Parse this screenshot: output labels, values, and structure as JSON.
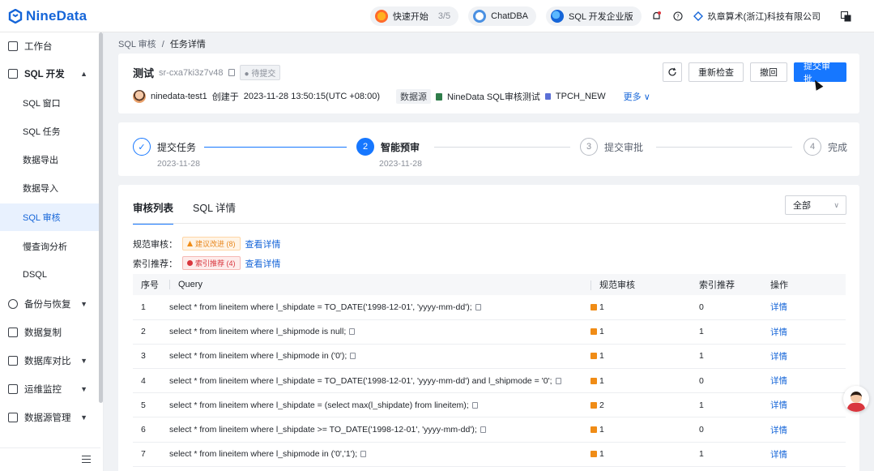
{
  "brand": {
    "name": "NineData"
  },
  "topbar": {
    "quick_start": "快速开始",
    "quick_start_progress": "3/5",
    "chatdba": "ChatDBA",
    "edition": "SQL 开发企业版",
    "company": "玖章算术(浙江)科技有限公司"
  },
  "sidebar": {
    "items": [
      {
        "label": "工作台",
        "icon": "home-icon"
      },
      {
        "label": "SQL 开发",
        "icon": "monitor-icon",
        "expanded": true
      },
      {
        "label": "备份与恢复",
        "icon": "backup-icon"
      },
      {
        "label": "数据复制",
        "icon": "replicate-icon"
      },
      {
        "label": "数据库对比",
        "icon": "compare-icon"
      },
      {
        "label": "运维监控",
        "icon": "monitor-ops-icon"
      },
      {
        "label": "数据源管理",
        "icon": "datasource-icon"
      }
    ],
    "sub_items": [
      "SQL 窗口",
      "SQL 任务",
      "数据导出",
      "数据导入",
      "SQL 审核",
      "慢查询分析",
      "DSQL"
    ],
    "active_sub": "SQL 审核"
  },
  "breadcrumb": {
    "parent": "SQL 审核",
    "separator": "/",
    "current": "任务详情"
  },
  "task": {
    "title": "测试",
    "id": "sr-cxa7ki3z7v48",
    "status": "待提交",
    "user": "ninedata-test1",
    "created_prefix": "创建于",
    "created_at": "2023-11-28 13:50:15(UTC +08:00)",
    "datasource_label": "数据源",
    "datasource": "NineData SQL审核测试",
    "database": "TPCH_NEW",
    "more": "更多"
  },
  "actions": {
    "refresh_icon": "refresh-icon",
    "recheck": "重新检查",
    "withdraw": "撤回",
    "submit": "提交审批"
  },
  "steps": [
    {
      "num": "1",
      "label": "提交任务",
      "date": "2023-11-28",
      "state": "done"
    },
    {
      "num": "2",
      "label": "智能预审",
      "date": "2023-11-28",
      "state": "active"
    },
    {
      "num": "3",
      "label": "提交审批",
      "date": "",
      "state": "pending"
    },
    {
      "num": "4",
      "label": "完成",
      "date": "",
      "state": "pending"
    }
  ],
  "review": {
    "tabs": [
      "审核列表",
      "SQL 详情"
    ],
    "filter": "全部",
    "rule_label": "规范审核：",
    "rule_tag": "建议改进 (8)",
    "index_label": "索引推荐：",
    "index_tag": "索引推荐 (4)",
    "view_details": "查看详情",
    "columns": [
      "序号",
      "Query",
      "规范审核",
      "索引推荐",
      "操作"
    ],
    "rows": [
      {
        "no": "1",
        "query": "select * from lineitem where l_shipdate = TO_DATE('1998-12-01', 'yyyy-mm-dd');",
        "rule": "1",
        "index": "0",
        "action": "详情"
      },
      {
        "no": "2",
        "query": "select * from lineitem where l_shipmode is null;",
        "rule": "1",
        "index": "1",
        "action": "详情"
      },
      {
        "no": "3",
        "query": "select * from lineitem where l_shipmode in ('0');",
        "rule": "1",
        "index": "1",
        "action": "详情"
      },
      {
        "no": "4",
        "query": "select * from lineitem where l_shipdate = TO_DATE('1998-12-01', 'yyyy-mm-dd') and l_shipmode = '0';",
        "rule": "1",
        "index": "0",
        "action": "详情"
      },
      {
        "no": "5",
        "query": "select * from lineitem where l_shipdate = (select max(l_shipdate) from lineitem);",
        "rule": "2",
        "index": "1",
        "action": "详情"
      },
      {
        "no": "6",
        "query": "select * from lineitem where l_shipdate >= TO_DATE('1998-12-01', 'yyyy-mm-dd');",
        "rule": "1",
        "index": "0",
        "action": "详情"
      },
      {
        "no": "7",
        "query": "select * from lineitem where l_shipmode in ('0','1');",
        "rule": "1",
        "index": "1",
        "action": "详情"
      }
    ]
  },
  "colors": {
    "primary": "#1677ff",
    "brand": "#1565d8",
    "warning": "#f08c16",
    "danger": "#d9363e"
  }
}
